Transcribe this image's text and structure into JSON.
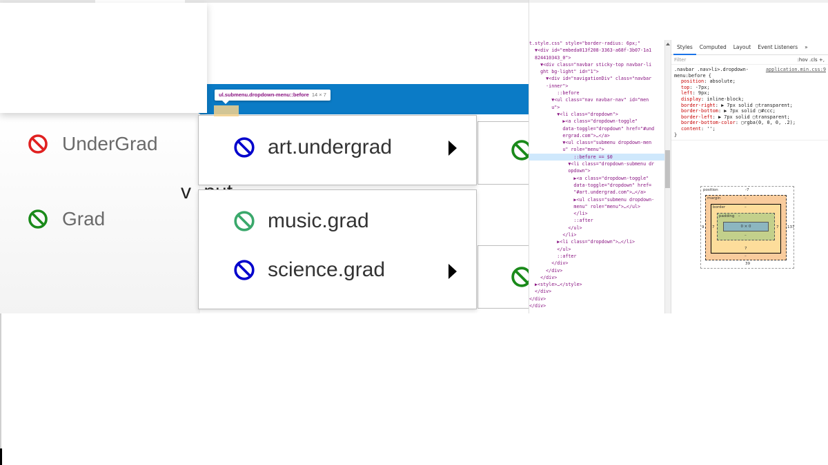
{
  "app": {
    "tooltip": {
      "selector": "ul.submenu.dropdown-menu::before",
      "size": "14 × 7"
    },
    "left_items": [
      {
        "label": "UnderGrad",
        "icon": "no-symbol-icon",
        "color": "#e02020"
      },
      {
        "label": "Grad",
        "icon": "no-symbol-icon",
        "color": "#1a8a1a"
      }
    ],
    "menu1_items": [
      {
        "label": "art.undergrad",
        "icon": "no-symbol-icon",
        "color": "#0000cc"
      }
    ],
    "menu2_items": [
      {
        "label": "music.grad",
        "icon": "no-symbol-icon",
        "color": "#3aa86b"
      },
      {
        "label": "science.grad",
        "icon": "no-symbol-icon",
        "color": "#0000cc"
      }
    ],
    "ghost_text": "v ·put",
    "side_icon_color": "#1a8a1a"
  },
  "devtools": {
    "elements_lines": [
      "t.style.css\" style=\"border-radius: 6px;\"",
      "  ▼<div id=\"embeda013f208-3363-a68f-3b07-1a1",
      "  824410343_0\">",
      "    ▼<div class=\"navbar sticky-top navbar-li",
      "    ght bg-light\" id=\"1\">",
      "      ▼<div id=\"navigationDiv\" class=\"navbar",
      "      -inner\">",
      "          ::before",
      "        ▼<ul class=\"nav navbar-nav\" id=\"men",
      "        u\">",
      "          ▼<li class=\"dropdown\">",
      "            ▶<a class=\"dropdown-toggle\"",
      "            data-toggle=\"dropdown\" href=\"#und",
      "            ergrad.com\">…</a>",
      "            ▼<ul class=\"submenu dropdown-men",
      "            u\" role=\"menu\">",
      "                ::before == $0",
      "              ▼<li class=\"dropdown-submenu dr",
      "              opdown\">",
      "                ▶<a class=\"dropdown-toggle\"",
      "                data-toggle=\"dropdown\" href=",
      "                \"#art.undergrad.com\">…</a>",
      "                ▶<ul class=\"submenu dropdown-",
      "                menu\" role=\"menu\">…</ul>",
      "                </li>",
      "                ::after",
      "              </ul>",
      "            </li>",
      "          ▶<li class=\"dropdown\">…</li>",
      "          </ul>",
      "          ::after",
      "        </div>",
      "      </div>",
      "    </div>",
      "  ▶<style>…</style>",
      "  </div>",
      "</div>",
      "</div>"
    ],
    "styles_tabs": [
      "Styles",
      "Computed",
      "Layout",
      "Event Listeners",
      "»"
    ],
    "filter_placeholder": "Filter",
    "filter_tools": ":hov  .cls  +,",
    "rule_selector": ".navbar .nav>li>.dropdown-menu:before {",
    "rule_source": "application.min.css:9",
    "rule_props": [
      {
        "name": "position",
        "value": "absolute;"
      },
      {
        "name": "top",
        "value": "-7px;"
      },
      {
        "name": "left",
        "value": "9px;"
      },
      {
        "name": "display",
        "value": "inline-block;"
      },
      {
        "name": "border-right",
        "value": "▶ 7px solid ▢transparent;"
      },
      {
        "name": "border-bottom",
        "value": "▶ 7px solid ▢#ccc;"
      },
      {
        "name": "border-left",
        "value": "▶ 7px solid ▢transparent;"
      },
      {
        "name": "border-bottom-color",
        "value": "▢rgba(0, 0, 0, .2);"
      },
      {
        "name": "content",
        "value": "'';"
      }
    ],
    "rule_close": "}",
    "boxmodel": {
      "position_label": "position",
      "position_top": "-7",
      "margin_label": "margin",
      "margin_value": "–",
      "border_label": "border",
      "border_value": "–",
      "padding_label": "padding",
      "padding_value": "–",
      "content": "0 × 0",
      "left_outer": "9",
      "left_inner": "7",
      "right_inner": "7",
      "right_outer": "137",
      "bottom_border": "7",
      "bottom_outer": "39"
    }
  }
}
